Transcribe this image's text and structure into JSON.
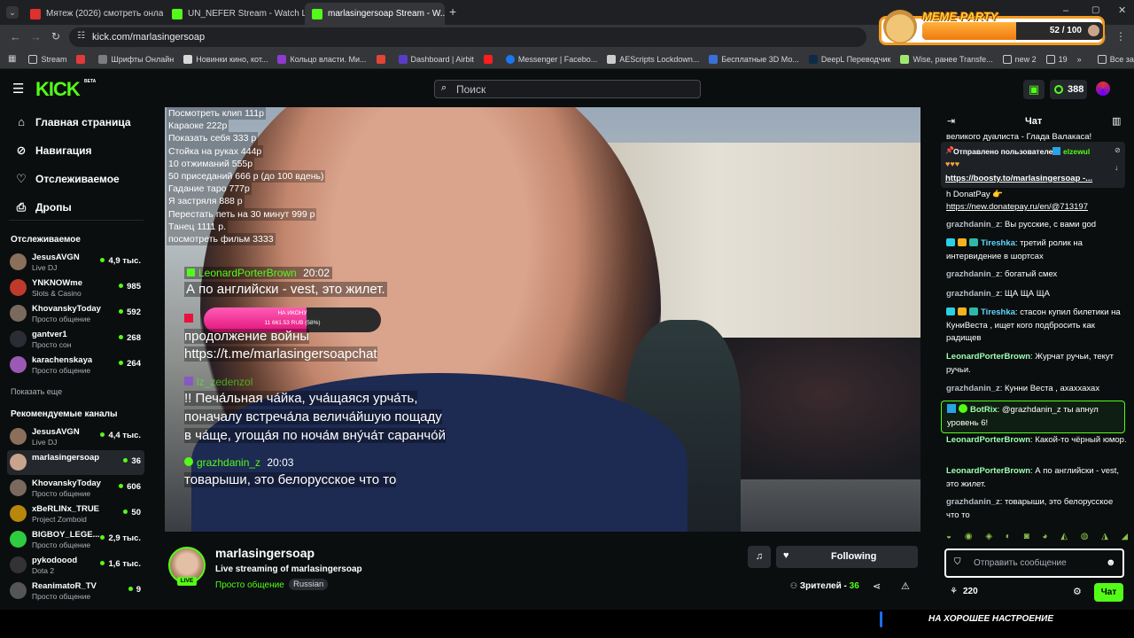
{
  "browser": {
    "tabs": [
      {
        "title": "Мятеж (2026) смотреть онлай...",
        "color": "#e02f2f"
      },
      {
        "title": "UN_NEFER Stream - Watch Live",
        "color": "#53fc18"
      },
      {
        "title": "marlasingersoap Stream - W...",
        "color": "#53fc18"
      }
    ],
    "url": "kick.com/marlasingersoap",
    "bookmarks": [
      {
        "label": "Stream",
        "color": "#c8ccd0"
      },
      {
        "label": "",
        "color": "#e23a3a"
      },
      {
        "label": "Шрифты Онлайн",
        "color": "#7d7d7d"
      },
      {
        "label": "Новинки кино, кот...",
        "color": "#d8d8d8"
      },
      {
        "label": "Кольцо власти. Ми...",
        "color": "#8e3bcf"
      },
      {
        "label": "",
        "color": "#e14534"
      },
      {
        "label": "Dashboard | Airbit",
        "color": "#5a3cc8"
      },
      {
        "label": "",
        "color": "#ff1e1e"
      },
      {
        "label": "Messenger | Facebo...",
        "color": "#1877f2"
      },
      {
        "label": "AEScripts Lockdown...",
        "color": "#cccccc"
      },
      {
        "label": "Бесплатные 3D Мо...",
        "color": "#3b6fd8"
      },
      {
        "label": "DeepL Переводчик",
        "color": "#0f2b46"
      },
      {
        "label": "Wise, ранее Transfe...",
        "color": "#9fe870"
      },
      {
        "label": "new 2",
        "color": "#c8ccd0"
      },
      {
        "label": "19",
        "color": "#c8ccd0"
      }
    ],
    "all_bookmarks": "Все закладки"
  },
  "meme_party": {
    "title": "MEME PARTY",
    "progress_label": "52 / 100",
    "progress": 0.52
  },
  "kick": {
    "logo": "KICK",
    "beta": "BETA",
    "search_placeholder": "Поиск",
    "points": "388"
  },
  "sidebar": {
    "nav": [
      {
        "label": "Главная страница",
        "icon": "home-icon"
      },
      {
        "label": "Навигация",
        "icon": "compass-icon"
      },
      {
        "label": "Отслеживаемое",
        "icon": "heart-icon"
      },
      {
        "label": "Дропы",
        "icon": "gift-icon"
      }
    ],
    "following_title": "Отслеживаемое",
    "following": [
      {
        "name": "JesusAVGN",
        "category": "Live DJ",
        "viewers": "4,9 тыс.",
        "color": "#8a6f5a"
      },
      {
        "name": "YNKNOWme",
        "category": "Slots & Casino",
        "viewers": "985",
        "color": "#c0392b"
      },
      {
        "name": "KhovanskyToday",
        "category": "Просто общение",
        "viewers": "592",
        "color": "#7a6a5e"
      },
      {
        "name": "gantver1",
        "category": "Просто сон",
        "viewers": "268",
        "color": "#2c2c34"
      },
      {
        "name": "karachenskaya",
        "category": "Просто общение",
        "viewers": "264",
        "color": "#9b59b6"
      }
    ],
    "show_more": "Показать еще",
    "recommended_title": "Рекомендуемые каналы",
    "recommended": [
      {
        "name": "JesusAVGN",
        "category": "Live DJ",
        "viewers": "4,4 тыс.",
        "color": "#8a6f5a"
      },
      {
        "name": "marlasingersoap",
        "category": "",
        "viewers": "36",
        "color": "#c9a48c"
      },
      {
        "name": "KhovanskyToday",
        "category": "Просто общение",
        "viewers": "606",
        "color": "#7a6a5e"
      },
      {
        "name": "xBeRLINx_TRUE",
        "category": "Project Zomboid",
        "viewers": "50",
        "color": "#b8860b"
      },
      {
        "name": "BIGBOY_LEGE...",
        "category": "Просто общение",
        "viewers": "2,9 тыс.",
        "color": "#2ecc40"
      },
      {
        "name": "pykodoood",
        "category": "Dota 2",
        "viewers": "1,6 тыс.",
        "color": "#333"
      },
      {
        "name": "ReanimatoR_TV",
        "category": "Просто общение",
        "viewers": "9",
        "color": "#555"
      }
    ]
  },
  "overlay": {
    "price_list": [
      "Посмотреть клип 111р",
      "Караоке 222р",
      "Показать себя 333 р",
      "Стойка на руках 444р",
      "10 отжиманий 555р",
      "50 приседаний 666 р (до 100 вдень)",
      "Гадание таро 777р",
      "Я застряля 888 р",
      "Перестать петь на 30 минут 999 р",
      "Танец 1111 р.",
      "посмотреть фильм 3333"
    ],
    "chat1_user": "LeonardPorterBrown",
    "chat1_time": "20:02",
    "chat1_text": "А по английски - vest, это жилет.",
    "donation_title": "НА ИКОНУ",
    "donation_amount": "11 661.53 RUB (58%)",
    "donation_progress": 0.58,
    "chat2_text_1": "продолжение войны",
    "chat2_text_2": "https://t.me/marlasingersoapchat",
    "chat3_user": "lz_zedenzol",
    "chat3_text_1": "!! Печа́льная ча́йка, уча́щаяся урча́ть,",
    "chat3_text_2": "поначалу встреча́ла велича́йшую пощаду",
    "chat3_text_3": "в ча́ще, угоща́я по ноча́м вну́ча́т саранчо́й",
    "chat4_user": "grazhdanin_z",
    "chat4_time": "20:03",
    "chat4_text": "товарыши, это белорусское что то"
  },
  "stream": {
    "channel": "marlasingersoap",
    "title": "Live streaming of marlasingersoap",
    "category": "Просто общение",
    "tag": "Russian",
    "live": "LIVE",
    "follow_label": "Following",
    "viewers_label": "Зрителей -",
    "viewers": "36"
  },
  "chat": {
    "title": "Чат",
    "top_fragment": "великого дуалиста - Глада Валакаса!",
    "pinned_label": "Отправлено пользователем",
    "pinned_user": "elzewul",
    "pinned_link": "https://boosty.to/marlasingersoap -...",
    "messages": [
      {
        "user": "",
        "text": "h DonatPay 👉"
      },
      {
        "user": "",
        "text": "https://new.donatepay.ru/en/@713197"
      },
      {
        "user": "grazhdanin_z",
        "text": "Вы русские, с вами god"
      },
      {
        "user": "Tireshka",
        "text": "третий ролик на интервидение в шортсах"
      },
      {
        "user": "grazhdanin_z",
        "text": "богатый смех"
      },
      {
        "user": "grazhdanin_z",
        "text": "ЩА ЩА ЩА"
      },
      {
        "user": "Tireshka",
        "text": "стасон купил билетики на КуниВеста , ищет кого подбросить как радищев"
      },
      {
        "user": "LeonardPorterBrown",
        "text": "Журчат ручьи, текут ручьи."
      },
      {
        "user": "grazhdanin_z",
        "text": "Кунни Веста , ахаххахах"
      },
      {
        "user": "BotRix",
        "text": "@grazhdanin_z ты апнул уровень 6!"
      },
      {
        "user": "LeonardPorterBrown",
        "text": "Какой-то чёрный юмор."
      },
      {
        "user": "LeonardPorterBrown",
        "text": "А по английски - vest, это жилет."
      },
      {
        "user": "grazhdanin_z",
        "text": "товарыши, это белорусское что то"
      }
    ],
    "input_placeholder": "Отправить сообщение",
    "points": "220",
    "send_label": "Чат"
  },
  "bottom_banner": "НА ХОРОШЕЕ НАСТРОЕНИЕ",
  "colors": {
    "accent": "#53fc18",
    "background": "#0b0e0f"
  }
}
